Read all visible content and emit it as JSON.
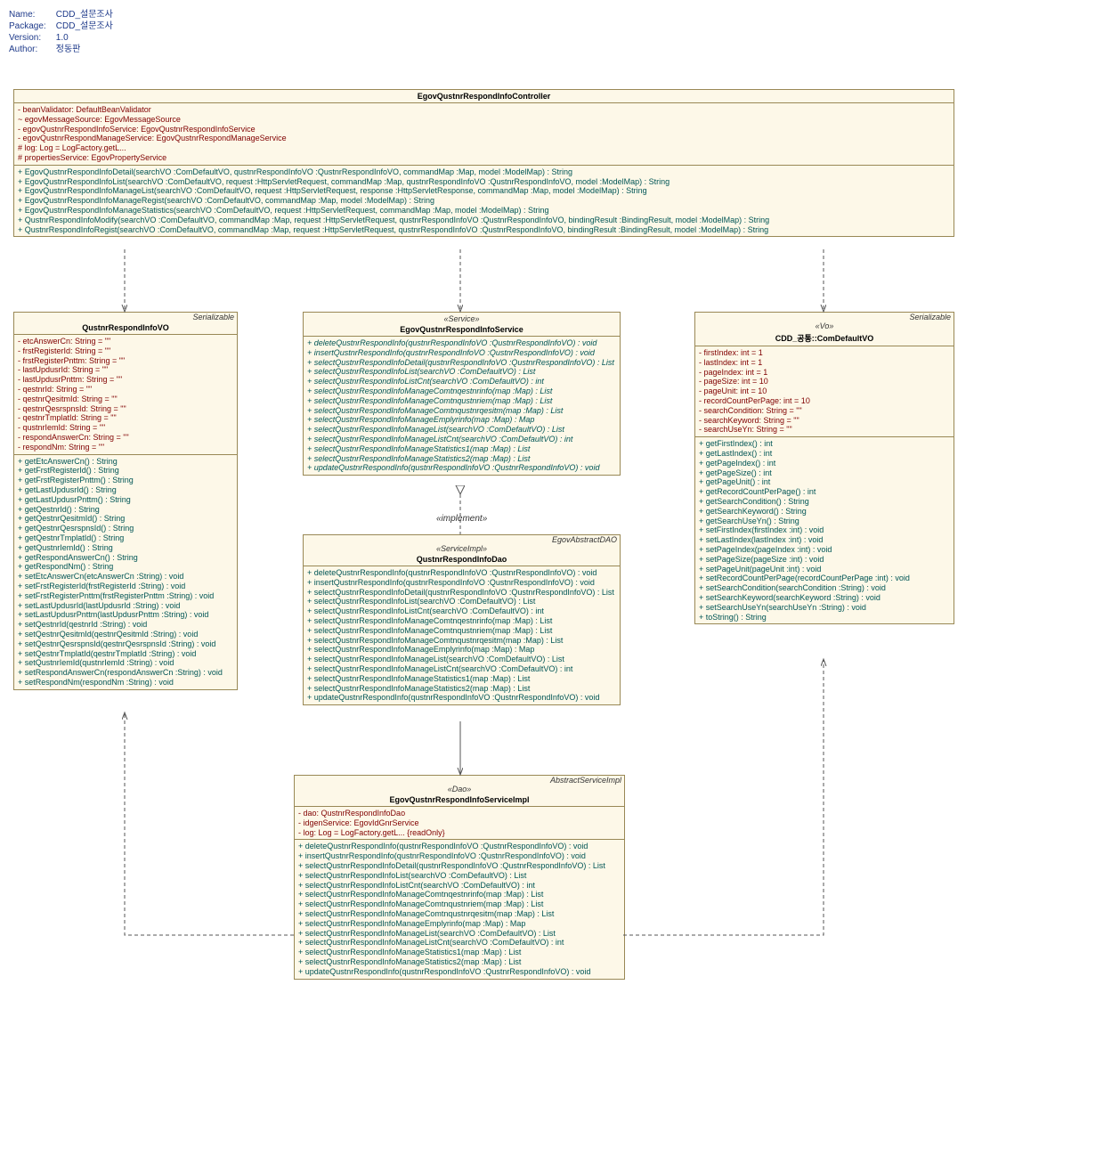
{
  "meta": {
    "nameLabel": "Name:",
    "name": "CDD_설문조사",
    "packageLabel": "Package:",
    "package": "CDD_설문조사",
    "versionLabel": "Version:",
    "version": "1.0",
    "authorLabel": "Author:",
    "author": "정동판"
  },
  "controller": {
    "title": "EgovQustnrRespondInfoController",
    "attrs": [
      "-   beanValidator:  DefaultBeanValidator",
      "~   egovMessageSource:  EgovMessageSource",
      "-   egovQustnrRespondInfoService:  EgovQustnrRespondInfoService",
      "-   egovQustnrRespondManageService:  EgovQustnrRespondManageService",
      "#   log:  Log = LogFactory.getL...",
      "#   propertiesService:  EgovPropertyService"
    ],
    "ops": [
      "+   EgovQustnrRespondInfoDetail(searchVO :ComDefaultVO, qustnrRespondInfoVO :QustnrRespondInfoVO, commandMap :Map, model :ModelMap) : String",
      "+   EgovQustnrRespondInfoList(searchVO :ComDefaultVO, request :HttpServletRequest, commandMap :Map, qustnrRespondInfoVO :QustnrRespondInfoVO, model :ModelMap) : String",
      "+   EgovQustnrRespondInfoManageList(searchVO :ComDefaultVO, request :HttpServletRequest, response :HttpServletResponse, commandMap :Map, model :ModelMap) : String",
      "+   EgovQustnrRespondInfoManageRegist(searchVO :ComDefaultVO, commandMap :Map, model :ModelMap) : String",
      "+   EgovQustnrRespondInfoManageStatistics(searchVO :ComDefaultVO, request :HttpServletRequest, commandMap :Map, model :ModelMap) : String",
      "+   QustnrRespondInfoModify(searchVO :ComDefaultVO, commandMap :Map, request :HttpServletRequest, qustnrRespondInfoVO :QustnrRespondInfoVO, bindingResult :BindingResult, model :ModelMap) : String",
      "+   QustnrRespondInfoRegist(searchVO :ComDefaultVO, commandMap :Map, request :HttpServletRequest, qustnrRespondInfoVO :QustnrRespondInfoVO, bindingResult :BindingResult, model :ModelMap) : String"
    ]
  },
  "vo": {
    "rightLabel": "Serializable",
    "title": "QustnrRespondInfoVO",
    "attrs": [
      "-   etcAnswerCn:  String = \"\"",
      "-   frstRegisterId:  String = \"\"",
      "-   frstRegisterPnttm:  String = \"\"",
      "-   lastUpdusrId:  String = \"\"",
      "-   lastUpdusrPnttm:  String = \"\"",
      "-   qestnrId:  String = \"\"",
      "-   qestnrQesitmId:  String = \"\"",
      "-   qestnrQesrspnsId:  String = \"\"",
      "-   qestnrTmplatId:  String = \"\"",
      "-   qustnrIemId:  String = \"\"",
      "-   respondAnswerCn:  String = \"\"",
      "-   respondNm:  String = \"\""
    ],
    "ops": [
      "+   getEtcAnswerCn() : String",
      "+   getFrstRegisterId() : String",
      "+   getFrstRegisterPnttm() : String",
      "+   getLastUpdusrId() : String",
      "+   getLastUpdusrPnttm() : String",
      "+   getQestnrId() : String",
      "+   getQestnrQesitmId() : String",
      "+   getQestnrQesrspnsId() : String",
      "+   getQestnrTmplatId() : String",
      "+   getQustnrIemId() : String",
      "+   getRespondAnswerCn() : String",
      "+   getRespondNm() : String",
      "+   setEtcAnswerCn(etcAnswerCn :String) : void",
      "+   setFrstRegisterId(frstRegisterId :String) : void",
      "+   setFrstRegisterPnttm(frstRegisterPnttm :String) : void",
      "+   setLastUpdusrId(lastUpdusrId :String) : void",
      "+   setLastUpdusrPnttm(lastUpdusrPnttm :String) : void",
      "+   setQestnrId(qestnrId :String) : void",
      "+   setQestnrQesitmId(qestnrQesitmId :String) : void",
      "+   setQestnrQesrspnsId(qestnrQesrspnsId :String) : void",
      "+   setQestnrTmplatId(qestnrTmplatId :String) : void",
      "+   setQustnrIemId(qustnrIemId :String) : void",
      "+   setRespondAnswerCn(respondAnswerCn :String) : void",
      "+   setRespondNm(respondNm :String) : void"
    ]
  },
  "service": {
    "stereotype": "«Service»",
    "title": "EgovQustnrRespondInfoService",
    "ops": [
      "+   deleteQustnrRespondInfo(qustnrRespondInfoVO :QustnrRespondInfoVO) : void",
      "+   insertQustnrRespondInfo(qustnrRespondInfoVO :QustnrRespondInfoVO) : void",
      "+   selectQustnrRespondInfoDetail(qustnrRespondInfoVO :QustnrRespondInfoVO) : List",
      "+   selectQustnrRespondInfoList(searchVO :ComDefaultVO) : List",
      "+   selectQustnrRespondInfoListCnt(searchVO :ComDefaultVO) : int",
      "+   selectQustnrRespondInfoManageComtnqestnrinfo(map :Map) : List",
      "+   selectQustnrRespondInfoManageComtnqustnriem(map :Map) : List",
      "+   selectQustnrRespondInfoManageComtnqustnrqesitm(map :Map) : List",
      "+   selectQustnrRespondInfoManageEmplyrinfo(map :Map) : Map",
      "+   selectQustnrRespondInfoManageList(searchVO :ComDefaultVO) : List",
      "+   selectQustnrRespondInfoManageListCnt(searchVO :ComDefaultVO) : int",
      "+   selectQustnrRespondInfoManageStatistics1(map :Map) : List",
      "+   selectQustnrRespondInfoManageStatistics2(map :Map) : List",
      "+   updateQustnrRespondInfo(qustnrRespondInfoVO :QustnrRespondInfoVO) : void"
    ]
  },
  "dao": {
    "rightLabel": "EgovAbstractDAO",
    "stereotype": "«ServiceImpl»",
    "title": "QustnrRespondInfoDao",
    "ops": [
      "+   deleteQustnrRespondInfo(qustnrRespondInfoVO :QustnrRespondInfoVO) : void",
      "+   insertQustnrRespondInfo(qustnrRespondInfoVO :QustnrRespondInfoVO) : void",
      "+   selectQustnrRespondInfoDetail(qustnrRespondInfoVO :QustnrRespondInfoVO) : List",
      "+   selectQustnrRespondInfoList(searchVO :ComDefaultVO) : List",
      "+   selectQustnrRespondInfoListCnt(searchVO :ComDefaultVO) : int",
      "+   selectQustnrRespondInfoManageComtnqestnrinfo(map :Map) : List",
      "+   selectQustnrRespondInfoManageComtnqustnriem(map :Map) : List",
      "+   selectQustnrRespondInfoManageComtnqustnrqesitm(map :Map) : List",
      "+   selectQustnrRespondInfoManageEmplyrinfo(map :Map) : Map",
      "+   selectQustnrRespondInfoManageList(searchVO :ComDefaultVO) : List",
      "+   selectQustnrRespondInfoManageListCnt(searchVO :ComDefaultVO) : int",
      "+   selectQustnrRespondInfoManageStatistics1(map :Map) : List",
      "+   selectQustnrRespondInfoManageStatistics2(map :Map) : List",
      "+   updateQustnrRespondInfo(qustnrRespondInfoVO :QustnrRespondInfoVO) : void"
    ]
  },
  "comvo": {
    "rightLabel": "Serializable",
    "stereotype": "«Vo»",
    "title": "CDD_공통::ComDefaultVO",
    "attrs": [
      "-   firstIndex:  int = 1",
      "-   lastIndex:  int = 1",
      "-   pageIndex:  int = 1",
      "-   pageSize:  int = 10",
      "-   pageUnit:  int = 10",
      "-   recordCountPerPage:  int = 10",
      "-   searchCondition:  String = \"\"",
      "-   searchKeyword:  String = \"\"",
      "-   searchUseYn:  String = \"\""
    ],
    "ops": [
      "+   getFirstIndex() : int",
      "+   getLastIndex() : int",
      "+   getPageIndex() : int",
      "+   getPageSize() : int",
      "+   getPageUnit() : int",
      "+   getRecordCountPerPage() : int",
      "+   getSearchCondition() : String",
      "+   getSearchKeyword() : String",
      "+   getSearchUseYn() : String",
      "+   setFirstIndex(firstIndex :int) : void",
      "+   setLastIndex(lastIndex :int) : void",
      "+   setPageIndex(pageIndex :int) : void",
      "+   setPageSize(pageSize :int) : void",
      "+   setPageUnit(pageUnit :int) : void",
      "+   setRecordCountPerPage(recordCountPerPage :int) : void",
      "+   setSearchCondition(searchCondition :String) : void",
      "+   setSearchKeyword(searchKeyword :String) : void",
      "+   setSearchUseYn(searchUseYn :String) : void",
      "+   toString() : String"
    ]
  },
  "impl": {
    "rightLabel": "AbstractServiceImpl",
    "stereotype": "«Dao»",
    "title": "EgovQustnrRespondInfoServiceImpl",
    "attrs": [
      "-   dao:  QustnrRespondInfoDao",
      "-   idgenService:  EgovIdGnrService",
      "-   log:  Log = LogFactory.getL... {readOnly}"
    ],
    "ops": [
      "+   deleteQustnrRespondInfo(qustnrRespondInfoVO :QustnrRespondInfoVO) : void",
      "+   insertQustnrRespondInfo(qustnrRespondInfoVO :QustnrRespondInfoVO) : void",
      "+   selectQustnrRespondInfoDetail(qustnrRespondInfoVO :QustnrRespondInfoVO) : List",
      "+   selectQustnrRespondInfoList(searchVO :ComDefaultVO) : List",
      "+   selectQustnrRespondInfoListCnt(searchVO :ComDefaultVO) : int",
      "+   selectQustnrRespondInfoManageComtnqestnrinfo(map :Map) : List",
      "+   selectQustnrRespondInfoManageComtnqustnriem(map :Map) : List",
      "+   selectQustnrRespondInfoManageComtnqustnrqesitm(map :Map) : List",
      "+   selectQustnrRespondInfoManageEmplyrinfo(map :Map) : Map",
      "+   selectQustnrRespondInfoManageList(searchVO :ComDefaultVO) : List",
      "+   selectQustnrRespondInfoManageListCnt(searchVO :ComDefaultVO) : int",
      "+   selectQustnrRespondInfoManageStatistics1(map :Map) : List",
      "+   selectQustnrRespondInfoManageStatistics2(map :Map) : List",
      "+   updateQustnrRespondInfo(qustnrRespondInfoVO :QustnrRespondInfoVO) : void"
    ]
  },
  "labels": {
    "implement": "«implement»"
  }
}
